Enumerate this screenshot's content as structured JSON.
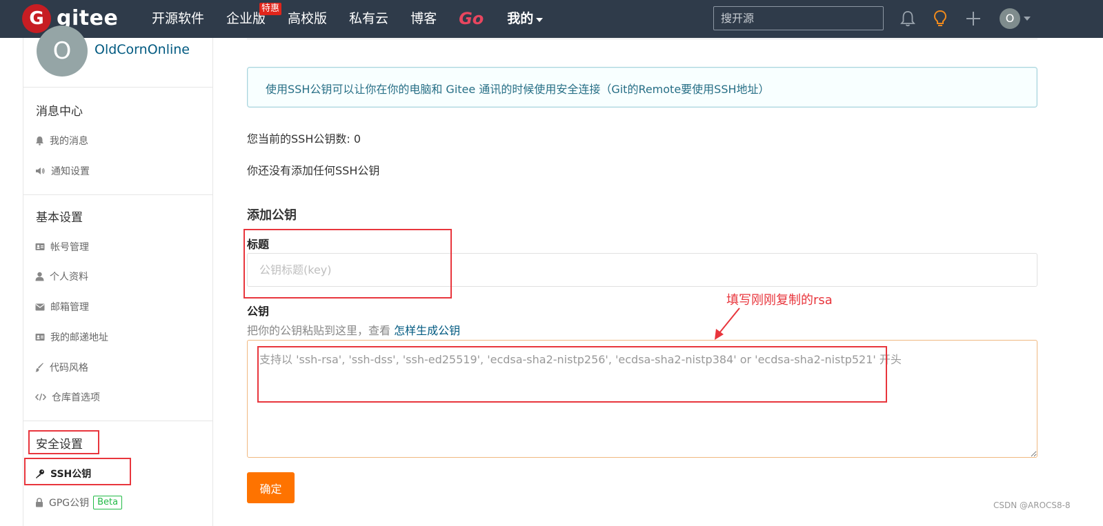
{
  "nav": {
    "logo_text": "gitee",
    "items": [
      {
        "label": "开源软件"
      },
      {
        "label": "企业版",
        "badge": "特惠"
      },
      {
        "label": "高校版"
      },
      {
        "label": "私有云"
      },
      {
        "label": "博客"
      }
    ],
    "go_label": "Go",
    "mine_label": "我的",
    "search_placeholder": "搜开源",
    "avatar_letter": "O",
    "icons": [
      "bell-icon",
      "lightbulb-icon",
      "plus-icon"
    ]
  },
  "sidebar": {
    "avatar_letter": "O",
    "username": "OldCornOnline",
    "sections": [
      {
        "title": "消息中心",
        "items": [
          {
            "label": "我的消息",
            "icon": "bell-icon"
          },
          {
            "label": "通知设置",
            "icon": "speaker-icon"
          }
        ]
      },
      {
        "title": "基本设置",
        "items": [
          {
            "label": "帐号管理",
            "icon": "id-card-icon"
          },
          {
            "label": "个人资料",
            "icon": "user-icon"
          },
          {
            "label": "邮箱管理",
            "icon": "envelope-icon"
          },
          {
            "label": "我的邮递地址",
            "icon": "address-card-icon"
          },
          {
            "label": "代码风格",
            "icon": "paintbrush-icon"
          },
          {
            "label": "仓库首选项",
            "icon": "code-icon"
          }
        ]
      },
      {
        "title": "安全设置",
        "items": [
          {
            "label": "SSH公钥",
            "icon": "key-icon",
            "active": true
          },
          {
            "label": "GPG公钥",
            "icon": "lock-icon",
            "badge": "Beta"
          }
        ]
      }
    ]
  },
  "main": {
    "info_message": "使用SSH公钥可以让你在你的电脑和 Gitee 通讯的时候使用安全连接（Git的Remote要使用SSH地址）",
    "key_count_text": "您当前的SSH公钥数: 0",
    "no_keys_text": "你还没有添加任何SSH公钥",
    "add_title": "添加公钥",
    "title_label": "标题",
    "title_placeholder": "公钥标题(key)",
    "key_label": "公钥",
    "help_text": "把你的公钥粘贴到这里，查看 ",
    "help_link": "怎样生成公钥",
    "key_placeholder": "支持以 'ssh-rsa', 'ssh-dss', 'ssh-ed25519', 'ecdsa-sha2-nistp256', 'ecdsa-sha2-nistp384' or 'ecdsa-sha2-nistp521' 开头",
    "submit_label": "确定"
  },
  "annotation": {
    "text": "填写刚刚复制的rsa"
  },
  "watermark": "CSDN @AROCS8-8",
  "colors": {
    "navbar": "#2f3b4a",
    "brand_red": "#c71d23",
    "primary_orange": "#fe7300",
    "link": "#005980",
    "annotation_red": "#e8353c"
  }
}
